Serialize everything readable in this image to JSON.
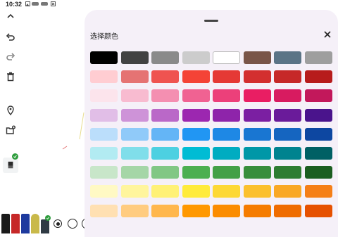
{
  "status_bar": {
    "time": "10:32",
    "notification_icons": [
      "image-icon",
      "line-app-icon",
      "line-app-icon",
      "text-recognition-icon"
    ]
  },
  "toolbar": {
    "icons": [
      "chevron-up-icon",
      "undo-icon",
      "redo-icon",
      "delete-icon",
      "location-pin-icon",
      "add-folder-icon",
      "eraser-icon"
    ]
  },
  "pens": {
    "colors": [
      "#1a1a1a",
      "#c62828",
      "#1e3a9e",
      "#c9b94a",
      "#2f3a44"
    ]
  },
  "color_picker": {
    "title": "选择颜色",
    "close_icon": "close-icon",
    "rows": [
      [
        "#000000",
        "#424242",
        "#8a8a8a",
        "#cccccc",
        "#ffffff",
        "#795548",
        "#5b7486",
        "#9e9e9e"
      ],
      [
        "#ffcdd2",
        "#e57373",
        "#ef5350",
        "#f44336",
        "#e53935",
        "#d32f2f",
        "#c62828",
        "#b71c1c"
      ],
      [
        "#fce4ec",
        "#f8bbd0",
        "#f48fb1",
        "#f06292",
        "#ec407a",
        "#e91e63",
        "#d81b60",
        "#c2185b"
      ],
      [
        "#e1bee7",
        "#ce93d8",
        "#ba68c8",
        "#9c27b0",
        "#8e24aa",
        "#7b1fa2",
        "#6a1b9a",
        "#4a148c"
      ],
      [
        "#bbdefb",
        "#90caf9",
        "#64b5f6",
        "#2196f3",
        "#1e88e5",
        "#1976d2",
        "#1565c0",
        "#0d47a1"
      ],
      [
        "#b2ebf2",
        "#80deea",
        "#4dd0e1",
        "#00bcd4",
        "#00acc1",
        "#0097a7",
        "#00838f",
        "#006064"
      ],
      [
        "#c8e6c9",
        "#a5d6a7",
        "#81c784",
        "#4caf50",
        "#43a047",
        "#388e3c",
        "#2e7d32",
        "#1b5e20"
      ],
      [
        "#fff9c4",
        "#fff59d",
        "#fff176",
        "#ffeb3b",
        "#fdd835",
        "#fbc02d",
        "#f9a825",
        "#f57f17"
      ],
      [
        "#ffe0b2",
        "#ffcc80",
        "#ffb74d",
        "#ff9800",
        "#fb8c00",
        "#f57c00",
        "#ef6c00",
        "#e65100"
      ]
    ]
  }
}
